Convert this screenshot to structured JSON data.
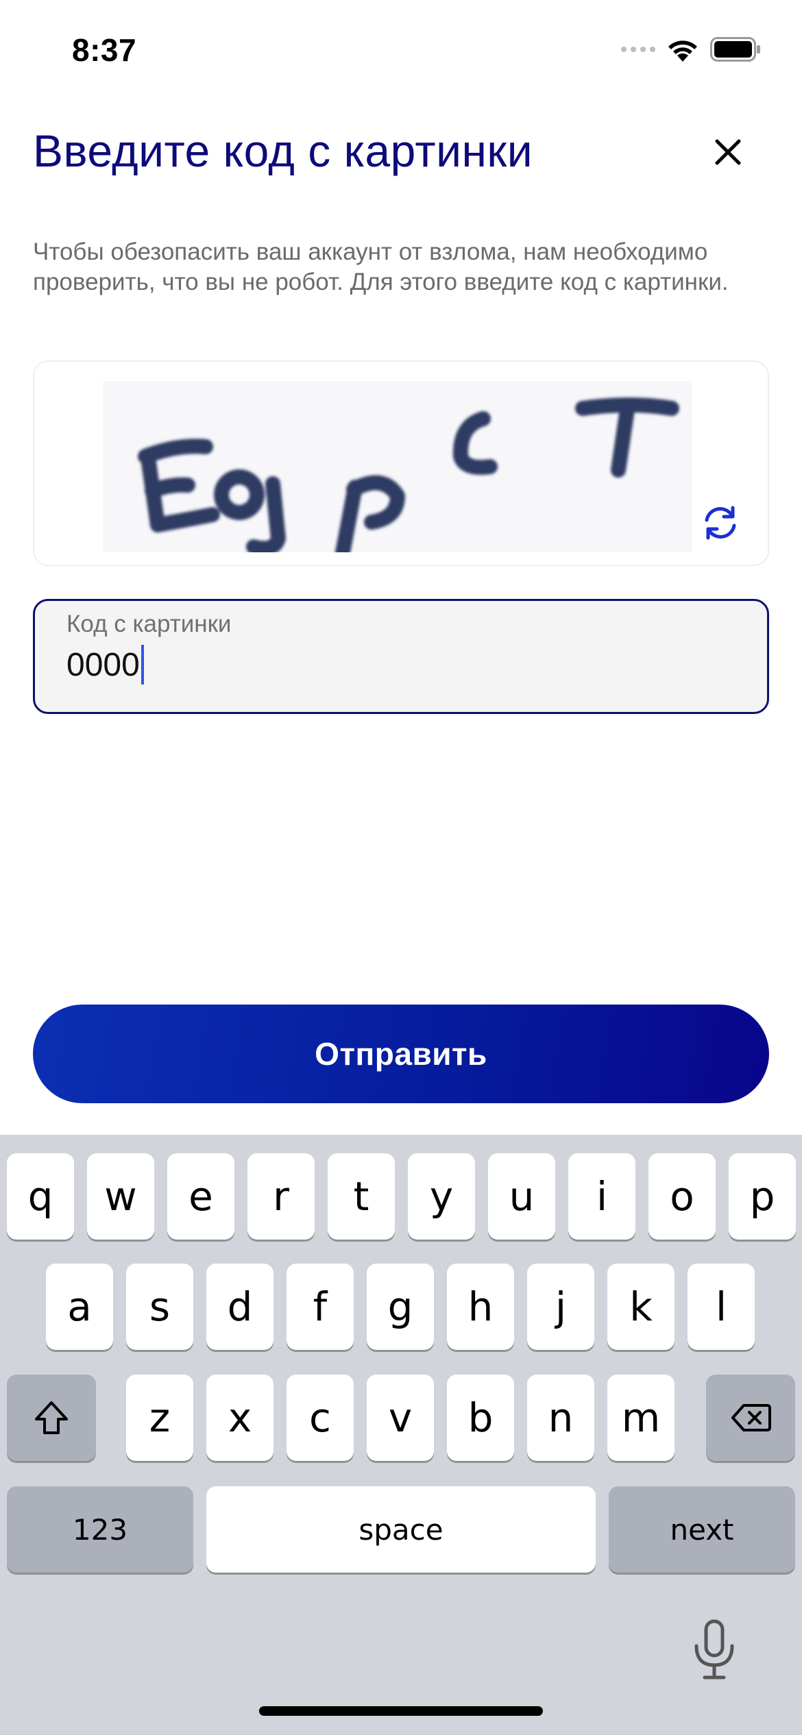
{
  "status_bar": {
    "time": "8:37"
  },
  "header": {
    "title": "Введите код с картинки"
  },
  "description": "Чтобы обезопасить ваш аккаунт от взлома, нам необходимо проверить, что вы не робот. Для этого введите код с картинки.",
  "captcha": {
    "text": "EgpcT"
  },
  "input": {
    "label": "Код с картинки",
    "value": "0000"
  },
  "submit": {
    "label": "Отправить"
  },
  "keyboard": {
    "row1": [
      "q",
      "w",
      "e",
      "r",
      "t",
      "y",
      "u",
      "i",
      "o",
      "p"
    ],
    "row2": [
      "a",
      "s",
      "d",
      "f",
      "g",
      "h",
      "j",
      "k",
      "l"
    ],
    "row3": [
      "z",
      "x",
      "c",
      "v",
      "b",
      "n",
      "m"
    ],
    "numbers_key": "123",
    "space_key": "space",
    "next_key": "next"
  },
  "icons": {
    "close": "close-icon",
    "refresh": "refresh-icon",
    "shift": "shift-icon",
    "backspace": "backspace-icon",
    "mic": "mic-icon"
  },
  "colors": {
    "title": "#0d0a7a",
    "input_border": "#10106e",
    "accent_blue": "#1a2fd6",
    "button_gradient_start": "#0b2fb4",
    "button_gradient_end": "#08068a"
  }
}
